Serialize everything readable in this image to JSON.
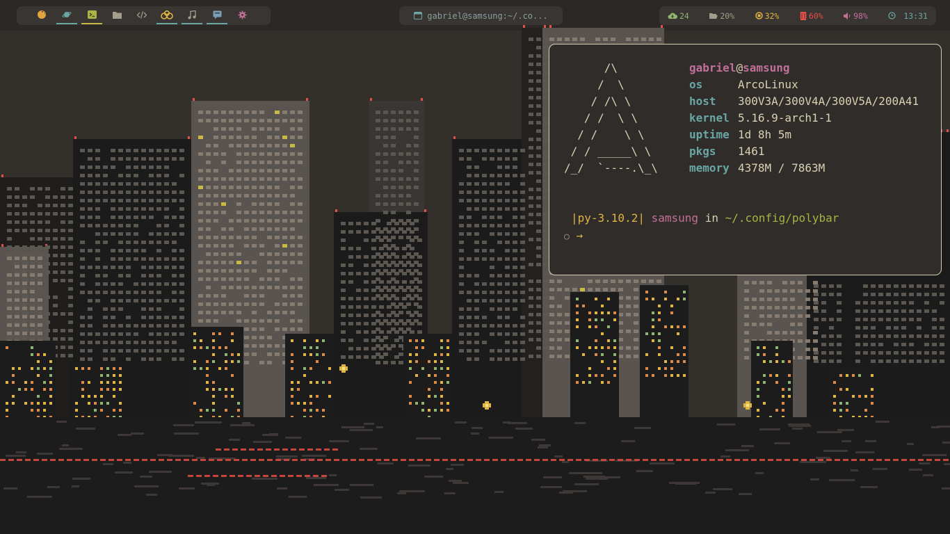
{
  "colors": {
    "bar_bg": "#393532",
    "terminal_bg": "#2f2c2a",
    "terminal_border": "#d6cfb6",
    "accent_teal": "#6aa6a4",
    "accent_pink": "#c2709a",
    "accent_yellow": "#e0b542",
    "accent_orange": "#e08a4a",
    "accent_green": "#a9b443",
    "accent_red": "#e0514a",
    "text_light": "#d9d1b3"
  },
  "bar": {
    "workspaces": [
      {
        "icon": "firefox-icon",
        "color": "#e0a53a",
        "underline": ""
      },
      {
        "icon": "planet-icon",
        "color": "#6aa6a4",
        "underline": "#6aa6a4"
      },
      {
        "icon": "terminal-icon",
        "color": "#a9b443",
        "underline": "#c9b944"
      },
      {
        "icon": "folder-icon",
        "color": "#a39d8c",
        "underline": ""
      },
      {
        "icon": "code-icon",
        "color": "#a39d8c",
        "underline": ""
      },
      {
        "icon": "users-icon",
        "color": "#e0b542",
        "underline": "#6aa6a4"
      },
      {
        "icon": "music-icon",
        "color": "#a39d8c",
        "underline": "#6aa6a4"
      },
      {
        "icon": "chat-icon",
        "color": "#7a9fb8",
        "underline": "#6aa6a4"
      },
      {
        "icon": "gear-icon",
        "color": "#c2709a",
        "underline": ""
      }
    ],
    "window_title": {
      "icon": "window-icon",
      "text": "gabriel@samsung:~/.co..."
    },
    "status": {
      "updates": {
        "icon": "cloud-download-icon",
        "value": "24",
        "color": "#8fb573"
      },
      "disk": {
        "icon": "folder-open-icon",
        "value": "20%",
        "color": "#a39d8c"
      },
      "cpu": {
        "icon": "cpu-icon",
        "value": "32%",
        "color": "#e0b542"
      },
      "memory": {
        "icon": "memory-icon",
        "value": "60%",
        "color": "#e0514a"
      },
      "volume": {
        "icon": "volume-icon",
        "value": "98%",
        "color": "#c2709a"
      },
      "clock": {
        "icon": "clock-icon",
        "value": "13:31",
        "color": "#6aa6a4"
      }
    }
  },
  "terminal": {
    "ascii_logo": "      /\\\n     /  \\\n    / /\\ \\\n   / /  \\ \\\n  / /    \\ \\\n / / _____\\ \\\n/_/  `----.\\_\\",
    "user": "gabriel",
    "at": "@",
    "host_name": "samsung",
    "info": [
      {
        "key": "os",
        "value": "ArcoLinux"
      },
      {
        "key": "host",
        "value": "300V3A/300V4A/300V5A/200A41"
      },
      {
        "key": "kernel",
        "value": "5.16.9-arch1-1"
      },
      {
        "key": "uptime",
        "value": "1d 8h 5m"
      },
      {
        "key": "pkgs",
        "value": "1461"
      },
      {
        "key": "memory",
        "value": "4378M / 7863M"
      }
    ],
    "prompt": {
      "python": "|py-3.10.2|",
      "host": "samsung",
      "in": "in",
      "path": "~/.config/polybar"
    },
    "cursor_line": {
      "circle": "○",
      "arrow": "→"
    }
  }
}
